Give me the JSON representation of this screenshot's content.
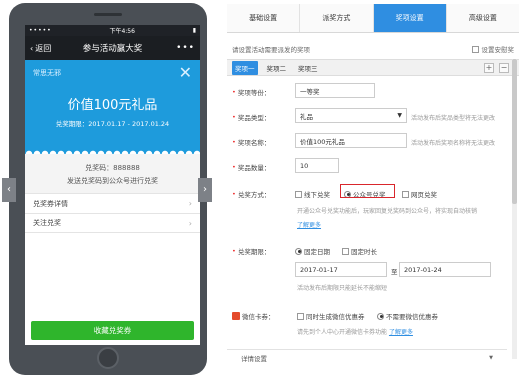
{
  "phone": {
    "status": {
      "signal": "•••••",
      "time": "下午4:56",
      "battery": "▮"
    },
    "title_bar": {
      "back": "返回",
      "title": "参与活动赢大奖",
      "more": "•••"
    },
    "coupon": {
      "tag": "常思无邪",
      "close": "✕",
      "headline": "价值100元礼品",
      "period": "兑奖期限：2017.01.17 - 2017.01.24"
    },
    "code": {
      "line1": "兑奖码：888888",
      "line2": "发送兑奖码到公众号进行兑奖"
    },
    "list": [
      {
        "label": "兑奖券详情"
      },
      {
        "label": "关注兑奖"
      }
    ],
    "redeem_button": "收藏兑奖券",
    "nav_left": "‹",
    "nav_right": "›"
  },
  "panel": {
    "tabs": [
      {
        "label": "基础设置"
      },
      {
        "label": "派奖方式"
      },
      {
        "label": "奖项设置"
      },
      {
        "label": "高级设置"
      }
    ],
    "active_tab_index": 2,
    "hint": "请设置活动需要派发的奖项",
    "safe_mode_label": "设置安慰奖",
    "prize_tabs": [
      {
        "label": "奖项一"
      },
      {
        "label": "奖项二"
      },
      {
        "label": "奖项三"
      }
    ],
    "add_button": "+",
    "remove_button": "−",
    "form": {
      "level_label": "奖项等份：",
      "level_value": "一等奖",
      "type_label": "奖品类型：",
      "type_value": "礼品",
      "type_note": "活动发布后奖品类型将无法更改",
      "name_label": "奖项名称：",
      "name_value": "价值100元礼品",
      "name_note": "活动发布后奖项名称将无法更改",
      "qty_label": "奖品数量：",
      "qty_value": "10",
      "method_label": "兑奖方式：",
      "method_options": [
        {
          "label": "线下兑奖"
        },
        {
          "label": "公众号兑奖"
        },
        {
          "label": "网页兑奖"
        }
      ],
      "method_note": "开通公众号兑奖功能后，玩家回复兑奖码到公众号，将实现自动核销",
      "learn_more": "了解更多",
      "period_label": "兑奖期限：",
      "period_options": [
        {
          "label": "固定日期"
        },
        {
          "label": "固定时长"
        }
      ],
      "date_start": "2017-01-17",
      "date_to": "至",
      "date_end": "2017-01-24",
      "period_note": "活动发布后期限只能延长不能缩短",
      "card_label": "微信卡券：",
      "card_options": [
        {
          "label": "同时生成微信优惠券"
        },
        {
          "label": "不需要微信优惠券"
        }
      ],
      "card_note": "请先到个人中心开通微信卡券功能",
      "card_learn_more": "了解更多",
      "detail_label": "详情设置",
      "detail_arrow": "▼"
    }
  }
}
